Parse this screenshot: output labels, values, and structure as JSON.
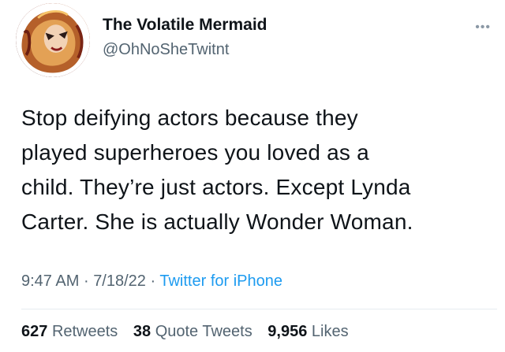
{
  "author": {
    "display_name": "The Volatile Mermaid",
    "handle": "@OhNoSheTwitnt"
  },
  "tweet": {
    "lines": [
      "Stop deifying actors because they",
      "played superheroes you loved as a",
      "child. They’re just actors. Except Lynda",
      "Carter. She is actually Wonder Woman."
    ]
  },
  "meta": {
    "time": "9:47 AM",
    "separator": "·",
    "date": "7/18/22",
    "source": "Twitter for iPhone"
  },
  "stats": {
    "retweets_count": "627",
    "retweets_label": "Retweets",
    "quotes_count": "38",
    "quotes_label": "Quote Tweets",
    "likes_count": "9,956",
    "likes_label": "Likes"
  },
  "icons": {
    "more": "more-options-icon",
    "avatar": "profile-avatar"
  },
  "colors": {
    "text": "#0f1419",
    "secondary": "#536471",
    "link": "#1d9bf0",
    "divider": "#e6ecf0"
  }
}
